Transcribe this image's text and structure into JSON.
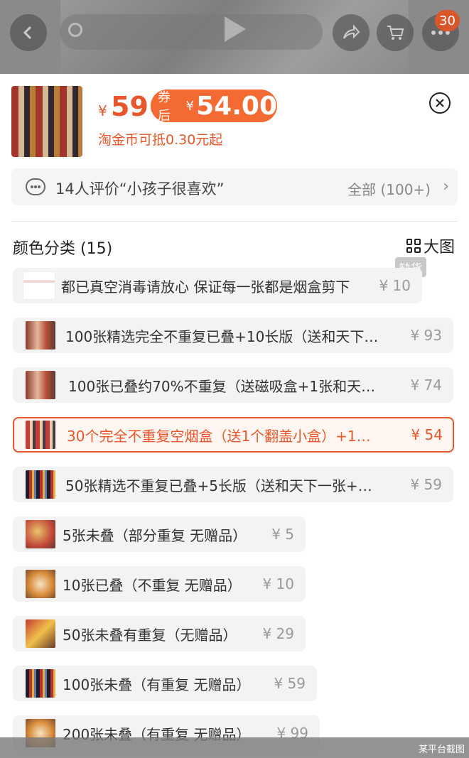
{
  "header": {
    "cart_count": "30",
    "icons": [
      "back-arrow-icon",
      "search-icon",
      "play-icon",
      "share-icon",
      "cart-icon",
      "more-icon"
    ]
  },
  "product": {
    "currency": "¥",
    "price": "59",
    "coupon_label": "券后",
    "coupon_currency": "¥",
    "coupon_price": "54.00",
    "coin_note": "淘金币可抵0.30元起"
  },
  "review": {
    "text": "14人评价“小孩子很喜欢”",
    "all_label": "全部 (100+)",
    "chevron": "›"
  },
  "section": {
    "title": "颜色分类 (15)",
    "big_image_label": "大图",
    "sold_out_tag": "缺货"
  },
  "options": [
    {
      "label": "都已真空消毒请放心 保证每一张都是烟盒剪下",
      "price": "¥ 10"
    },
    {
      "label": "100张精选完全不重复已叠+10长版（送和天下…",
      "price": "¥ 93"
    },
    {
      "label": "100张已叠约70%不重复（送磁吸盒+1张和天…",
      "price": "¥ 74"
    },
    {
      "label": "30个完全不重复空烟盒（送1个翻盖小盒）+1…",
      "price": "¥ 54"
    },
    {
      "label": "50张精选不重复已叠+5长版（送和天下一张+…",
      "price": "¥ 59"
    },
    {
      "label": "5张未叠（部分重复 无赠品）",
      "price": "¥ 5"
    },
    {
      "label": "10张已叠（不重复 无赠品）",
      "price": "¥ 10"
    },
    {
      "label": "50张未叠有重复（无赠品）",
      "price": "¥ 29"
    },
    {
      "label": "100张未叠（有重复 无赠品）",
      "price": "¥ 59"
    },
    {
      "label": "200张未叠（有重复 无赠品）",
      "price": "¥ 99"
    }
  ],
  "colors": {
    "accent": "#e8572b",
    "coupon_bg": "#f36b33"
  },
  "watermark": "某平台截图"
}
